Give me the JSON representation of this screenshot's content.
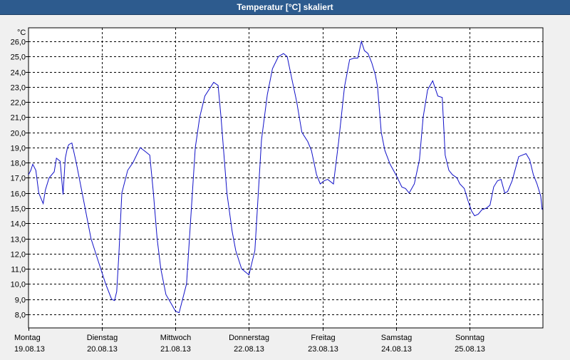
{
  "window": {
    "title": "Temperatur [°C] skaliert"
  },
  "chart_data": {
    "type": "line",
    "title": "Temperatur [°C] skaliert",
    "ylabel": "°C",
    "ylim": [
      7.1,
      26.9
    ],
    "yticks": [
      8.0,
      9.0,
      10.0,
      11.0,
      12.0,
      13.0,
      14.0,
      15.0,
      16.0,
      17.0,
      18.0,
      19.0,
      20.0,
      21.0,
      22.0,
      23.0,
      24.0,
      25.0,
      26.0
    ],
    "ytick_labels": [
      "8,0",
      "9,0",
      "10,0",
      "11,0",
      "12,0",
      "13,0",
      "14,0",
      "15,0",
      "16,0",
      "17,0",
      "18,0",
      "19,0",
      "20,0",
      "21,0",
      "22,0",
      "23,0",
      "24,0",
      "25,0",
      "26,0"
    ],
    "xlim": [
      0,
      7
    ],
    "xticks": [
      {
        "day": "Montag",
        "date": "19.08.13"
      },
      {
        "day": "Dienstag",
        "date": "20.08.13"
      },
      {
        "day": "Mittwoch",
        "date": "21.08.13"
      },
      {
        "day": "Donnerstag",
        "date": "22.08.13"
      },
      {
        "day": "Freitag",
        "date": "23.08.13"
      },
      {
        "day": "Samstag",
        "date": "24.08.13"
      },
      {
        "day": "Sonntag",
        "date": "25.08.13"
      }
    ],
    "grid": true,
    "line_color": "#1010c8",
    "series": [
      {
        "x": [
          0.0,
          0.031,
          0.058,
          0.1,
          0.14,
          0.2,
          0.23,
          0.28,
          0.35,
          0.38,
          0.43,
          0.47,
          0.5,
          0.53,
          0.55,
          0.59,
          0.65,
          0.75,
          0.85,
          0.93,
          1.05,
          1.13,
          1.17,
          1.2,
          1.23,
          1.27,
          1.35,
          1.42,
          1.52,
          1.6,
          1.65,
          1.7,
          1.75,
          1.8,
          1.87,
          1.93,
          2.0,
          2.05,
          2.15,
          2.27,
          2.33,
          2.4,
          2.52,
          2.58,
          2.62,
          2.7,
          2.77,
          2.82,
          2.9,
          3.0,
          3.08,
          3.17,
          3.25,
          3.32,
          3.4,
          3.47,
          3.52,
          3.58,
          3.65,
          3.72,
          3.8,
          3.85,
          3.92,
          3.97,
          4.02,
          4.07,
          4.15,
          4.22,
          4.3,
          4.37,
          4.43,
          4.48,
          4.53,
          4.57,
          4.62,
          4.67,
          4.72,
          4.75,
          4.8,
          4.85,
          4.92,
          5.0,
          5.08,
          5.13,
          5.18,
          5.25,
          5.32,
          5.37,
          5.43,
          5.5,
          5.57,
          5.63,
          5.67,
          5.72,
          5.77,
          5.83,
          5.87,
          5.93,
          5.98,
          6.03,
          6.07,
          6.12,
          6.17,
          6.23,
          6.28,
          6.33,
          6.38,
          6.43,
          6.48,
          6.52,
          6.58,
          6.62,
          6.67,
          6.72,
          6.77,
          6.82,
          6.87,
          6.92,
          6.97,
          6.99
        ],
        "values": [
          17.2,
          17.5,
          17.9,
          17.5,
          16.0,
          15.3,
          16.2,
          17.0,
          17.4,
          18.3,
          18.1,
          15.9,
          18.3,
          19.0,
          19.2,
          19.3,
          18.0,
          15.5,
          13.0,
          11.8,
          10.0,
          9.0,
          8.9,
          9.5,
          12.0,
          16.0,
          17.5,
          18.0,
          19.0,
          18.7,
          18.5,
          16.0,
          13.0,
          11.0,
          9.3,
          8.8,
          8.2,
          8.1,
          10.0,
          19.0,
          21.0,
          22.4,
          23.3,
          23.1,
          21.0,
          16.0,
          13.5,
          12.2,
          11.0,
          10.6,
          12.2,
          19.5,
          22.5,
          24.2,
          25.0,
          25.2,
          25.0,
          23.6,
          22.0,
          20.0,
          19.4,
          18.8,
          17.2,
          16.6,
          16.8,
          16.9,
          16.6,
          19.4,
          23.0,
          24.8,
          24.9,
          24.9,
          26.0,
          25.4,
          25.2,
          24.6,
          23.8,
          23.0,
          20.0,
          18.8,
          17.9,
          17.2,
          16.4,
          16.3,
          16.0,
          16.6,
          18.2,
          21.0,
          22.8,
          23.4,
          22.4,
          22.3,
          18.5,
          17.5,
          17.2,
          17.0,
          16.6,
          16.3,
          15.5,
          14.8,
          14.5,
          14.6,
          14.9,
          15.0,
          15.2,
          16.4,
          16.8,
          16.9,
          16.0,
          16.1,
          16.8,
          17.5,
          18.4,
          18.5,
          18.6,
          18.2,
          17.2,
          16.6,
          15.8,
          14.9
        ]
      }
    ]
  }
}
